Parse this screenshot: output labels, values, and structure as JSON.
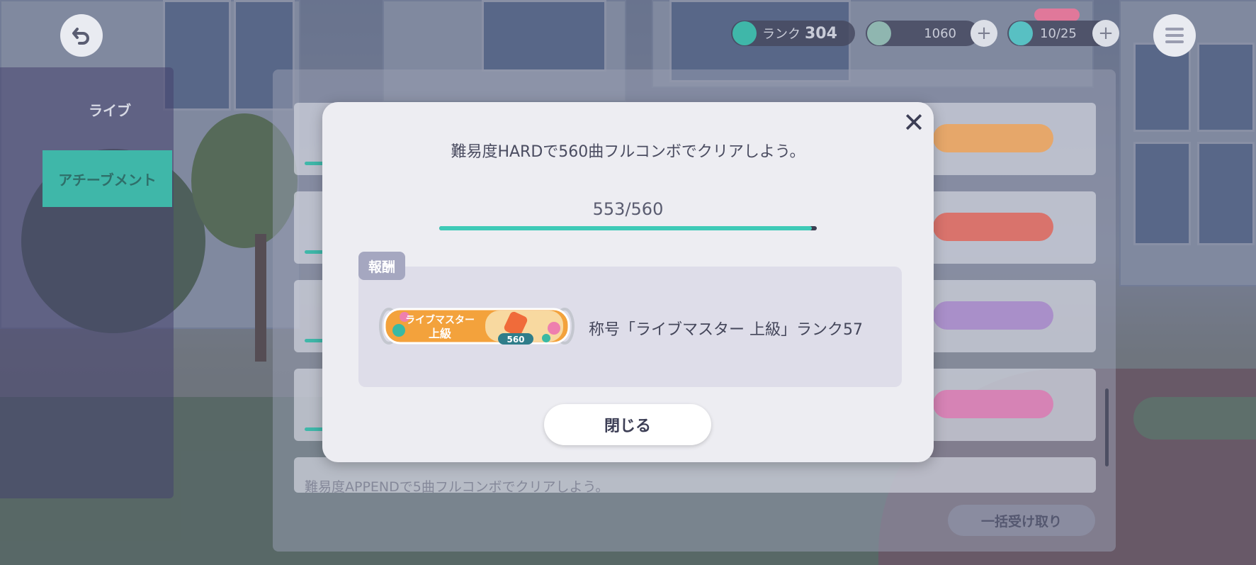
{
  "hud": {
    "rank_label": "ランク",
    "rank_value": "304",
    "crystal_value": "1060",
    "energy_value": "10/25"
  },
  "side_tabs": [
    {
      "label": "ライブ"
    },
    {
      "label": "アチーブメント"
    }
  ],
  "background_list": {
    "last_row_text": "難易度APPENDで5曲フルコンボでクリアしよう。",
    "collect_all_label": "一括受け取り"
  },
  "modal": {
    "mission_text": "難易度HARDで560曲フルコンボでクリアしよう。",
    "progress_text": "553/560",
    "progress_value": 0.9875,
    "reward_tag": "報酬",
    "reward_badge_line1": "ライブマスター",
    "reward_badge_line2": "上級",
    "reward_badge_number": "560",
    "reward_text": "称号「ライブマスター 上級」ランク57",
    "close_button_label": "閉じる"
  },
  "colors": {
    "accent_teal": "#3ecab7",
    "modal_bg": "#ededf2",
    "reward_box_bg": "#dedde9"
  },
  "icons": [
    "back-icon",
    "menu-icon",
    "close-icon",
    "plus-icon"
  ]
}
